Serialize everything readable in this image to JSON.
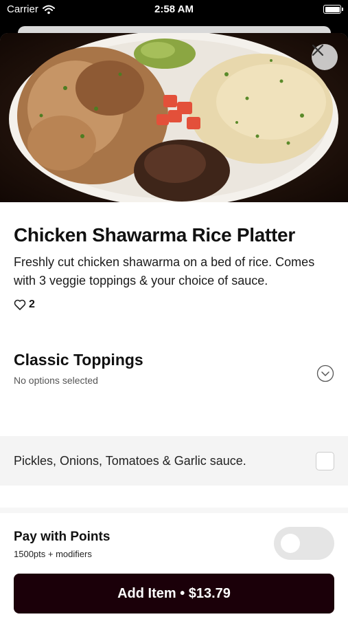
{
  "status_bar": {
    "carrier": "Carrier",
    "time": "2:58 AM"
  },
  "item": {
    "title": "Chicken Shawarma Rice Platter",
    "description": "Freshly cut chicken shawarma on a bed of rice. Comes with 3 veggie toppings & your choice of sauce.",
    "likes": "2"
  },
  "section": {
    "title": "Classic Toppings",
    "subtitle": "No options selected",
    "options": [
      {
        "label": "Pickles, Onions, Tomatoes & Garlic sauce.",
        "checked": false
      }
    ]
  },
  "points": {
    "title": "Pay with Points",
    "subtitle": "1500pts + modifiers",
    "enabled": false
  },
  "add_button": {
    "label": "Add Item • $13.79"
  },
  "colors": {
    "button_bg": "#1b0009",
    "hero_bg": "#1b0e08",
    "toggle_off": "#e5e5e5"
  }
}
